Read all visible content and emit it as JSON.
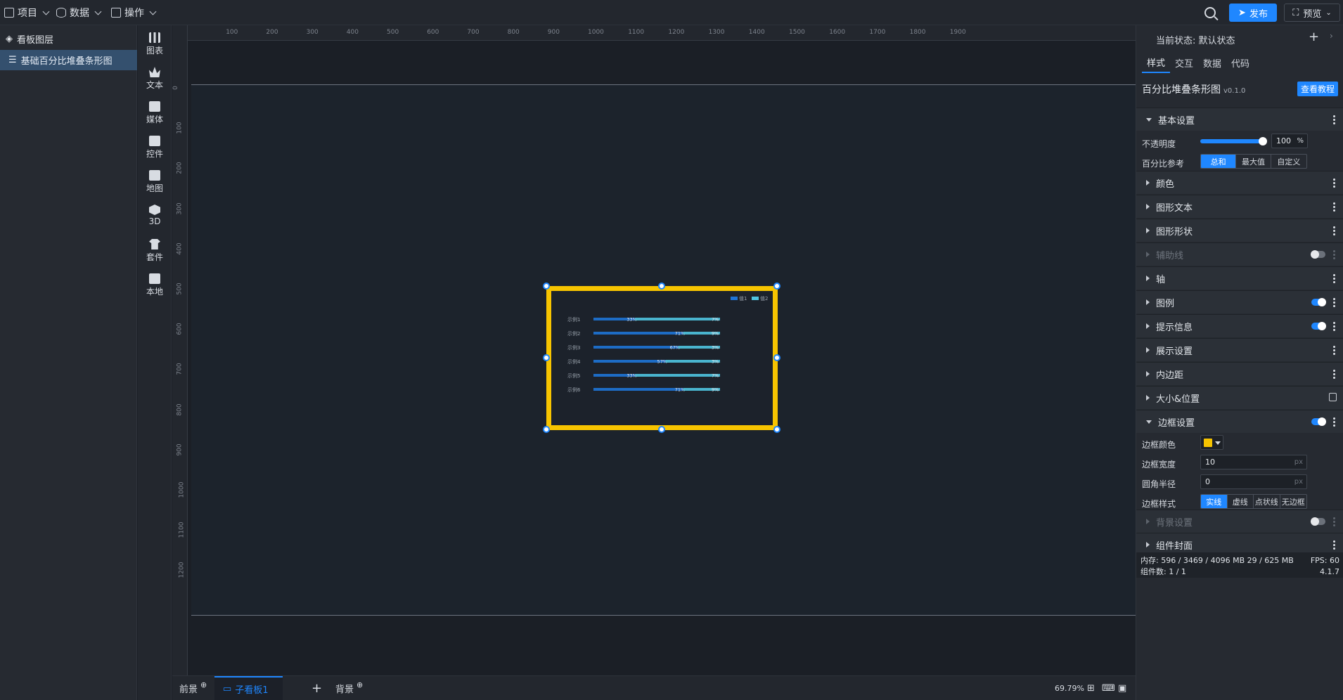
{
  "topbar": {
    "menus": [
      {
        "label": "项目",
        "icon": "file-icon"
      },
      {
        "label": "数据",
        "icon": "database-icon"
      },
      {
        "label": "操作",
        "icon": "grid-icon"
      }
    ],
    "publish_label": "发布",
    "preview_label": "预览"
  },
  "layers": {
    "title": "看板图层",
    "items": [
      {
        "label": "基础百分比堆叠条形图"
      }
    ]
  },
  "tools": [
    {
      "label": "图表",
      "icon": "chart-icon"
    },
    {
      "label": "文本",
      "icon": "text-icon"
    },
    {
      "label": "媒体",
      "icon": "media-icon"
    },
    {
      "label": "控件",
      "icon": "control-icon"
    },
    {
      "label": "地图",
      "icon": "map-icon"
    },
    {
      "label": "3D",
      "icon": "cube-icon"
    },
    {
      "label": "套件",
      "icon": "suite-icon"
    },
    {
      "label": "本地",
      "icon": "puzzle-icon"
    }
  ],
  "ruler": {
    "top": [
      "100",
      "200",
      "300",
      "400",
      "500",
      "600",
      "700",
      "800",
      "900",
      "1000",
      "1100",
      "1200",
      "1300",
      "1400",
      "1500",
      "1600",
      "1700",
      "1800",
      "1900"
    ],
    "left": [
      "0",
      "100",
      "200",
      "300",
      "400",
      "500",
      "600",
      "700",
      "800",
      "900",
      "1000",
      "1100",
      "1200"
    ]
  },
  "chart_data": {
    "type": "bar",
    "orientation": "horizontal",
    "stacking": "percent",
    "categories": [
      "示例1",
      "示例2",
      "示例3",
      "示例4",
      "示例5",
      "示例6"
    ],
    "series": [
      {
        "name": "值1",
        "values": [
          33,
          71,
          67,
          57,
          33,
          71
        ],
        "labels": [
          "33%",
          "71%",
          "67%",
          "57%",
          "33%",
          "71%"
        ],
        "color": "#1e74d6"
      },
      {
        "name": "值2",
        "values": [
          67,
          29,
          33,
          43,
          67,
          29
        ],
        "labels": [
          "7%",
          "9%",
          "3%",
          "3%",
          "7%",
          "9%"
        ],
        "color": "#4fc4e0"
      }
    ],
    "legend": "top-right",
    "border_color": "#f7c400"
  },
  "bottom": {
    "tabs": [
      {
        "label": "前景"
      },
      {
        "label": "子看板1"
      },
      {
        "label": "背景"
      }
    ],
    "zoom": "69.79%"
  },
  "right": {
    "state_label": "当前状态:",
    "state_value": "默认状态",
    "tabs": [
      "样式",
      "交互",
      "数据",
      "代码"
    ],
    "component_name": "百分比堆叠条形图",
    "component_version": "v0.1.0",
    "tutorial_label": "查看教程",
    "sections_top": {
      "basic": "基本设置"
    },
    "opacity_label": "不透明度",
    "opacity_value": "100",
    "opacity_unit": "%",
    "opacity_level": 1.0,
    "percent_ref_label": "百分比参考",
    "percent_ref_options": [
      "总和",
      "最大值",
      "自定义"
    ],
    "sections": [
      {
        "label": "颜色",
        "toggle": null
      },
      {
        "label": "图形文本",
        "toggle": null
      },
      {
        "label": "图形形状",
        "toggle": null
      },
      {
        "label": "辅助线",
        "toggle": "off",
        "dim": true
      },
      {
        "label": "轴",
        "toggle": null
      },
      {
        "label": "图例",
        "toggle": "on"
      },
      {
        "label": "提示信息",
        "toggle": "on"
      },
      {
        "label": "展示设置",
        "toggle": null
      },
      {
        "label": "内边距",
        "toggle": null
      },
      {
        "label": "大小&位置",
        "lock": true
      }
    ],
    "border_section": "边框设置",
    "border_color_label": "边框颜色",
    "border_color": "#f7c400",
    "border_width_label": "边框宽度",
    "border_width": "10",
    "border_width_unit": "px",
    "radius_label": "圆角半径",
    "radius_value": "0",
    "radius_unit": "px",
    "border_style_label": "边框样式",
    "border_style_options": [
      "实线",
      "虚线",
      "点状线",
      "无边框"
    ],
    "bg_section": "背景设置",
    "cover_section": "组件封面",
    "status_line1": "内存: 596 / 3469 / 4096 MB  29 / 625 MB",
    "status_fps": "FPS:  60",
    "status_line2": "组件数: 1 / 1",
    "version": "4.1.7"
  }
}
